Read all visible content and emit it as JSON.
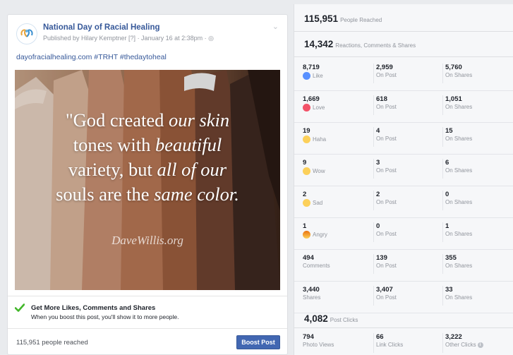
{
  "post": {
    "page_name": "National Day of Racial Healing",
    "published_line": "Published by Hilary Kemptner [?] · January 16 at 2:38pm · ◎",
    "menu_glyph": "⌄",
    "link_text": "dayofracialhealing.com #TRHT #thedaytoheal",
    "image_quote": {
      "line1_plain": "\"God created ",
      "line1_italic": "our skin",
      "line2_plain": "tones with ",
      "line2_italic": "beautiful",
      "line3_plain": "variety, but ",
      "line3_italic": "all of our",
      "line4_plain": "souls are the ",
      "line4_italic": "same color.",
      "attribution": "DaveWillis.org"
    },
    "promo_title": "Get More Likes, Comments and Shares",
    "promo_subtitle": "When you boost this post, you'll show it to more people.",
    "reached_text": "115,951 people reached",
    "boost_label": "Boost Post"
  },
  "insights": {
    "people_reached": {
      "value": "115,951",
      "label": "People Reached"
    },
    "engagement": {
      "value": "14,342",
      "label": "Reactions, Comments & Shares"
    },
    "rows": [
      {
        "icon": "like-icon",
        "total": "8,719",
        "total_label": "Like",
        "on_post": "2,959",
        "on_post_label": "On Post",
        "on_shares": "5,760",
        "on_shares_label": "On Shares"
      },
      {
        "icon": "love-icon",
        "total": "1,669",
        "total_label": "Love",
        "on_post": "618",
        "on_post_label": "On Post",
        "on_shares": "1,051",
        "on_shares_label": "On Shares"
      },
      {
        "icon": "haha-icon",
        "total": "19",
        "total_label": "Haha",
        "on_post": "4",
        "on_post_label": "On Post",
        "on_shares": "15",
        "on_shares_label": "On Shares"
      },
      {
        "icon": "wow-icon",
        "total": "9",
        "total_label": "Wow",
        "on_post": "3",
        "on_post_label": "On Post",
        "on_shares": "6",
        "on_shares_label": "On Shares"
      },
      {
        "icon": "sad-icon",
        "total": "2",
        "total_label": "Sad",
        "on_post": "2",
        "on_post_label": "On Post",
        "on_shares": "0",
        "on_shares_label": "On Shares"
      },
      {
        "icon": "angry-icon",
        "total": "1",
        "total_label": "Angry",
        "on_post": "0",
        "on_post_label": "On Post",
        "on_shares": "1",
        "on_shares_label": "On Shares"
      },
      {
        "icon": "",
        "total": "494",
        "total_label": "Comments",
        "on_post": "139",
        "on_post_label": "On Post",
        "on_shares": "355",
        "on_shares_label": "On Shares"
      },
      {
        "icon": "",
        "total": "3,440",
        "total_label": "Shares",
        "on_post": "3,407",
        "on_post_label": "On Post",
        "on_shares": "33",
        "on_shares_label": "On Shares"
      }
    ],
    "post_clicks": {
      "value": "4,082",
      "label": "Post Clicks"
    },
    "clicks": [
      {
        "value": "794",
        "label": "Photo Views"
      },
      {
        "value": "66",
        "label": "Link Clicks"
      },
      {
        "value": "3,222",
        "label": "Other Clicks"
      }
    ],
    "info_glyph": "i"
  },
  "colors": {
    "link_blue": "#365899",
    "boost_blue": "#4267b2",
    "check_green": "#42b72a",
    "muted_gray": "#90949c"
  }
}
